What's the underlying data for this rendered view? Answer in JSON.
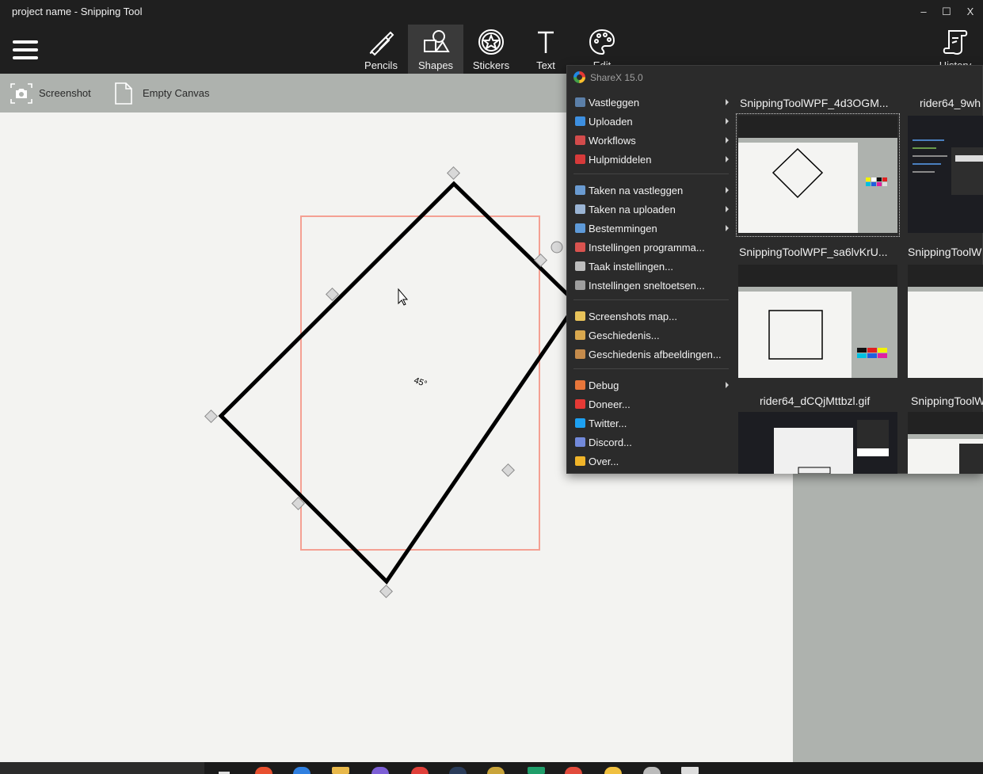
{
  "window": {
    "title": "project name - Snipping Tool",
    "controls": {
      "minimize": "–",
      "maximize": "☐",
      "close": "X"
    }
  },
  "toolbar": {
    "tools": [
      {
        "label": "Pencils",
        "icon": "pencils-icon"
      },
      {
        "label": "Shapes",
        "icon": "shapes-icon",
        "active": true
      },
      {
        "label": "Stickers",
        "icon": "stickers-icon"
      },
      {
        "label": "Text",
        "icon": "text-icon"
      },
      {
        "label": "Edit",
        "icon": "palette-icon"
      }
    ],
    "history_label": "History"
  },
  "subbar": {
    "screenshot_label": "Screenshot",
    "empty_canvas_label": "Empty Canvas"
  },
  "canvas": {
    "rotation_label": "45°",
    "shape_color": "#000000",
    "selection_color": "#f4a093"
  },
  "sharex_menu": {
    "title": "ShareX 15.0",
    "groups": [
      [
        {
          "label": "Vastleggen",
          "submenu": true,
          "color": "#5b7fa8"
        },
        {
          "label": "Uploaden",
          "submenu": true,
          "color": "#3d8fe0"
        },
        {
          "label": "Workflows",
          "submenu": true,
          "color": "#d24b4b"
        },
        {
          "label": "Hulpmiddelen",
          "submenu": true,
          "color": "#d63a3a"
        }
      ],
      [
        {
          "label": "Taken na vastleggen",
          "submenu": true,
          "color": "#6a9bd1"
        },
        {
          "label": "Taken na uploaden",
          "submenu": true,
          "color": "#9ab4d4"
        },
        {
          "label": "Bestemmingen",
          "submenu": true,
          "color": "#5e9ad8"
        },
        {
          "label": "Instellingen programma...",
          "submenu": false,
          "color": "#d9534f"
        },
        {
          "label": "Taak instellingen...",
          "submenu": false,
          "color": "#bdbdbd"
        },
        {
          "label": "Instellingen sneltoetsen...",
          "submenu": false,
          "color": "#9e9e9e"
        }
      ],
      [
        {
          "label": "Screenshots map...",
          "submenu": false,
          "color": "#e8c35a"
        },
        {
          "label": "Geschiedenis...",
          "submenu": false,
          "color": "#d9a84e"
        },
        {
          "label": "Geschiedenis afbeeldingen...",
          "submenu": false,
          "color": "#c58b4b"
        }
      ],
      [
        {
          "label": "Debug",
          "submenu": true,
          "color": "#e8763a"
        },
        {
          "label": "Doneer...",
          "submenu": false,
          "color": "#e53935"
        },
        {
          "label": "Twitter...",
          "submenu": false,
          "color": "#1da1f2"
        },
        {
          "label": "Discord...",
          "submenu": false,
          "color": "#7289da"
        },
        {
          "label": "Over...",
          "submenu": false,
          "color": "#f0b429"
        }
      ]
    ],
    "thumbnails": [
      "SnippingToolWPF_4d3OGM...",
      "rider64_9wh",
      "SnippingToolWPF_sa6lvKrU...",
      "SnippingToolW",
      "rider64_dCQjMttbzl.gif",
      "SnippingToolW"
    ]
  }
}
